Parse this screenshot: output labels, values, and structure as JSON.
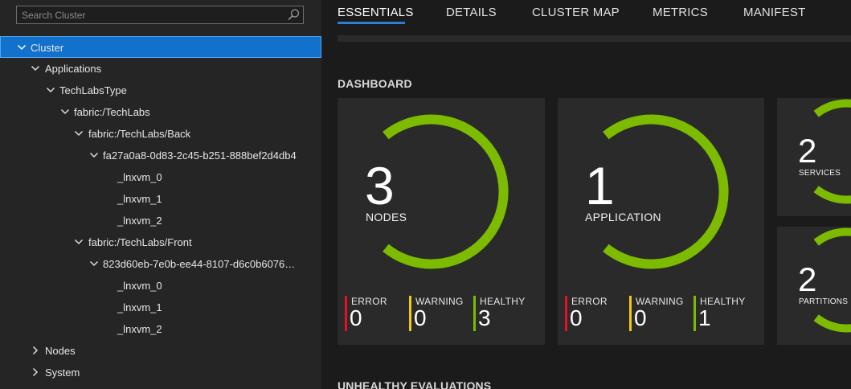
{
  "search": {
    "placeholder": "Search Cluster"
  },
  "tree": {
    "cluster": "Cluster",
    "applications": "Applications",
    "app_type": "TechLabsType",
    "app": "fabric:/TechLabs",
    "service_back": "fabric:/TechLabs/Back",
    "partition_back": "fa27a0a8-0d83-2c45-b251-888bef2d4db4",
    "back_replicas": [
      "_lnxvm_0",
      "_lnxvm_1",
      "_lnxvm_2"
    ],
    "service_front": "fabric:/TechLabs/Front",
    "partition_front": "823d60eb-7e0b-ee44-8107-d6c0b6076…",
    "front_replicas": [
      "_lnxvm_0",
      "_lnxvm_1",
      "_lnxvm_2"
    ],
    "nodes": "Nodes",
    "system": "System"
  },
  "tabs": [
    "ESSENTIALS",
    "DETAILS",
    "CLUSTER MAP",
    "METRICS",
    "MANIFEST"
  ],
  "active_tab": "ESSENTIALS",
  "dashboard": {
    "title": "DASHBOARD",
    "nodes": {
      "count": "3",
      "label": "NODES",
      "error": "0",
      "warning": "0",
      "healthy": "3"
    },
    "applications": {
      "count": "1",
      "label": "APPLICATION",
      "error": "0",
      "warning": "0",
      "healthy": "1"
    },
    "services": {
      "count": "2",
      "label": "SERVICES"
    },
    "partitions": {
      "count": "2",
      "label": "PARTITIONS"
    },
    "stat_labels": {
      "error": "ERROR",
      "warning": "WARNING",
      "healthy": "HEALTHY"
    }
  },
  "unhealthy_title": "UNHEALTHY EVALUATIONS",
  "colors": {
    "accent": "#1171cc",
    "ring": "#7cbb00",
    "error": "#e81123",
    "warning": "#f2c811",
    "healthy": "#7cbb00"
  }
}
